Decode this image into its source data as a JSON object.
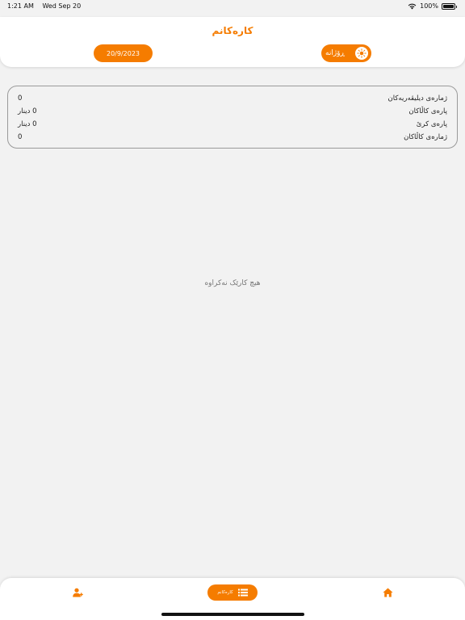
{
  "status": {
    "time": "1:21 AM",
    "date": "Wed Sep 20",
    "battery": "100%"
  },
  "header": {
    "title": "کارەکانم",
    "date": "20/9/2023",
    "period_label": "ڕۆژانە"
  },
  "summary": {
    "rows": [
      {
        "label": "ژمارەی دیلیڤەریەکان",
        "value": "0"
      },
      {
        "label": "پارەی کاڵاکان",
        "value": "0 دینار"
      },
      {
        "label": "پارەی کرێ",
        "value": "0 دینار"
      },
      {
        "label": "ژمارەی کاڵاکان",
        "value": "0"
      }
    ]
  },
  "empty_message": "هیچ کارێک نەکراوە",
  "bottom_nav": {
    "center_label": "کارەکانم"
  },
  "colors": {
    "accent": "#f57c00",
    "background": "#f2f2f2",
    "card_border": "#9a9a9a"
  },
  "icons": {
    "profile": "person-add-icon",
    "center": "list-icon",
    "home": "home-icon",
    "period": "sun-icon"
  }
}
